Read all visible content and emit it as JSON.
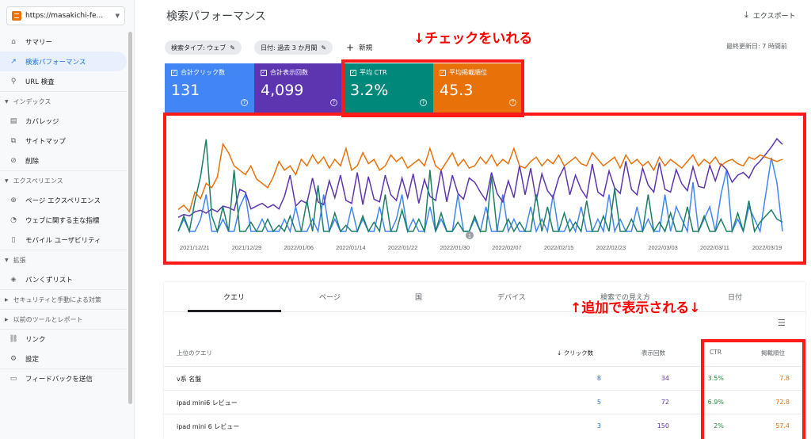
{
  "property": {
    "label": "https://masakichi-fe..."
  },
  "sidebar": {
    "items": [
      {
        "icon": "⌂",
        "label": "サマリー"
      },
      {
        "icon": "↗",
        "label": "検索パフォーマンス"
      },
      {
        "icon": "⚲",
        "label": "URL 検査"
      }
    ],
    "sections": [
      {
        "label": "インデックス",
        "items": [
          {
            "icon": "▤",
            "label": "カバレッジ"
          },
          {
            "icon": "⧉",
            "label": "サイトマップ"
          },
          {
            "icon": "⊘",
            "label": "削除"
          }
        ]
      },
      {
        "label": "エクスペリエンス",
        "items": [
          {
            "icon": "⊕",
            "label": "ページ エクスペリエンス"
          },
          {
            "icon": "◔",
            "label": "ウェブに関する主な指標"
          },
          {
            "icon": "▯",
            "label": "モバイル ユーザビリティ"
          }
        ]
      },
      {
        "label": "拡張",
        "items": [
          {
            "icon": "◈",
            "label": "パンくずリスト"
          }
        ]
      }
    ],
    "collapsed": [
      "セキュリティと手動による対策",
      "以前のツールとレポート"
    ],
    "bottom": [
      {
        "icon": "⛓",
        "label": "リンク"
      },
      {
        "icon": "⚙",
        "label": "設定"
      },
      {
        "icon": "▭",
        "label": "フィードバックを送信"
      }
    ]
  },
  "header": {
    "title": "検索パフォーマンス",
    "export": "エクスポート",
    "export_icon": "⤓"
  },
  "filters": {
    "search_type": "検索タイプ: ウェブ",
    "date": "日付: 過去 3 か月間",
    "new": "新規",
    "updated": "最終更新日: 7 時間前"
  },
  "annotations": {
    "top": "↓チェックをいれる",
    "bottom": "↑追加で表示される↓"
  },
  "cards": [
    {
      "label": "合計クリック数",
      "value": "131",
      "color": "#4285f4"
    },
    {
      "label": "合計表示回数",
      "value": "4,099",
      "color": "#5e35b1"
    },
    {
      "label": "平均 CTR",
      "value": "3.2%",
      "color": "#00897b"
    },
    {
      "label": "平均掲載順位",
      "value": "45.3",
      "color": "#e8710a"
    }
  ],
  "chart_data": {
    "type": "line",
    "x_labels": [
      "2021/12/21",
      "2021/12/29",
      "2022/01/06",
      "2022/01/14",
      "2022/01/22",
      "2022/01/30",
      "2022/02/07",
      "2022/02/15",
      "2022/02/23",
      "2022/03/03",
      "2022/03/11",
      "2022/03/19"
    ],
    "annotation_marker": "1",
    "series": [
      {
        "name": "クリック数",
        "color": "#4285f4",
        "values": [
          0,
          1,
          0,
          0,
          1,
          3,
          0,
          0,
          1,
          0,
          0,
          2,
          3,
          0,
          0,
          1,
          0,
          0,
          0,
          1,
          0,
          2,
          0,
          0,
          1,
          0,
          3,
          0,
          1,
          0,
          0,
          2,
          0,
          1,
          0,
          0,
          2,
          0,
          0,
          1,
          3,
          0,
          1,
          0,
          0,
          2,
          0,
          1,
          0,
          0,
          3,
          0,
          0,
          1,
          0,
          2,
          0,
          0,
          3,
          0,
          1,
          0,
          0,
          2,
          0,
          1,
          0,
          3,
          0,
          0,
          1,
          0,
          2,
          0,
          0,
          1,
          0,
          3,
          0,
          1,
          0,
          0,
          2,
          0,
          1,
          0,
          0,
          3,
          0,
          2,
          1,
          0,
          4,
          0,
          1,
          2,
          0,
          3,
          5,
          0,
          1,
          0,
          2,
          1,
          0,
          3,
          6,
          4,
          0
        ]
      },
      {
        "name": "表示回数",
        "color": "#5e35b1",
        "values": [
          10,
          12,
          11,
          14,
          15,
          13,
          16,
          14,
          18,
          17,
          15,
          30,
          28,
          16,
          18,
          20,
          17,
          19,
          16,
          25,
          40,
          18,
          22,
          20,
          38,
          21,
          19,
          36,
          24,
          40,
          22,
          20,
          42,
          19,
          39,
          23,
          21,
          40,
          26,
          22,
          38,
          24,
          41,
          20,
          37,
          25,
          22,
          44,
          21,
          40,
          27,
          23,
          38,
          35,
          28,
          22,
          42,
          27,
          21,
          36,
          24,
          47,
          26,
          45,
          22,
          41,
          29,
          24,
          38,
          46,
          26,
          40,
          30,
          24,
          48,
          28,
          25,
          43,
          31,
          27,
          50,
          30,
          26,
          45,
          33,
          28,
          49,
          30,
          28,
          44,
          34,
          29,
          46,
          32,
          31,
          47,
          36,
          48,
          44,
          35,
          40,
          42,
          38,
          46,
          50,
          55,
          60,
          66,
          62
        ]
      },
      {
        "name": "CTR",
        "color": "#1a7f64",
        "values": [
          0,
          5,
          0,
          10,
          18,
          30,
          5,
          0,
          8,
          0,
          20,
          0,
          0,
          3,
          0,
          0,
          4,
          0,
          2,
          0,
          5,
          0,
          0,
          10,
          0,
          15,
          0,
          0,
          6,
          0,
          2,
          0,
          0,
          5,
          0,
          3,
          0,
          12,
          0,
          0,
          7,
          0,
          0,
          4,
          0,
          20,
          0,
          6,
          0,
          0,
          3,
          0,
          0,
          5,
          0,
          0,
          18,
          0,
          0,
          4,
          0,
          3,
          0,
          0,
          12,
          0,
          8,
          0,
          0,
          6,
          0,
          3,
          0,
          10,
          0,
          0,
          5,
          0,
          14,
          0,
          0,
          4,
          0,
          0,
          12,
          0,
          3,
          0,
          6,
          0,
          0,
          8,
          0,
          0,
          5,
          0,
          0,
          4,
          0,
          0,
          6,
          0,
          10,
          0,
          3,
          5,
          7,
          4,
          3
        ]
      },
      {
        "name": "掲載順位",
        "color": "#e8710a",
        "values": [
          10,
          12,
          9,
          18,
          15,
          22,
          20,
          25,
          40,
          36,
          30,
          28,
          26,
          30,
          24,
          22,
          20,
          25,
          32,
          28,
          30,
          26,
          33,
          30,
          35,
          31,
          34,
          29,
          33,
          30,
          38,
          28,
          30,
          36,
          31,
          33,
          28,
          30,
          35,
          32,
          34,
          29,
          31,
          33,
          30,
          38,
          30,
          28,
          32,
          36,
          30,
          33,
          29,
          30,
          34,
          31,
          35,
          30,
          33,
          31,
          38,
          30,
          29,
          32,
          34,
          30,
          33,
          31,
          35,
          30,
          32,
          34,
          31,
          30,
          36,
          33,
          30,
          32,
          34,
          29,
          35,
          31,
          33,
          30,
          32,
          28,
          34,
          30,
          33,
          31,
          29,
          32,
          35,
          30,
          33,
          31,
          34,
          30,
          32,
          33,
          31,
          30,
          34,
          33,
          35,
          34,
          33,
          32,
          33
        ]
      }
    ]
  },
  "tabs": [
    "クエリ",
    "ページ",
    "国",
    "デバイス",
    "検索での見え方",
    "日付"
  ],
  "table": {
    "headers": {
      "query": "上位のクエリ",
      "clicks": "クリック数",
      "impressions": "表示回数",
      "ctr": "CTR",
      "position": "掲載順位",
      "sort_icon": "↓"
    },
    "rows": [
      {
        "query": "v系 名盤",
        "clicks": "8",
        "impressions": "34",
        "ctr": "3.5%",
        "position": "7.8"
      },
      {
        "query": "ipad mini6 レビュー",
        "clicks": "5",
        "impressions": "72",
        "ctr": "6.9%",
        "position": "72.8"
      },
      {
        "query": "ipad mini 6 レビュー",
        "clicks": "3",
        "impressions": "150",
        "ctr": "2%",
        "position": "57.4"
      }
    ]
  }
}
